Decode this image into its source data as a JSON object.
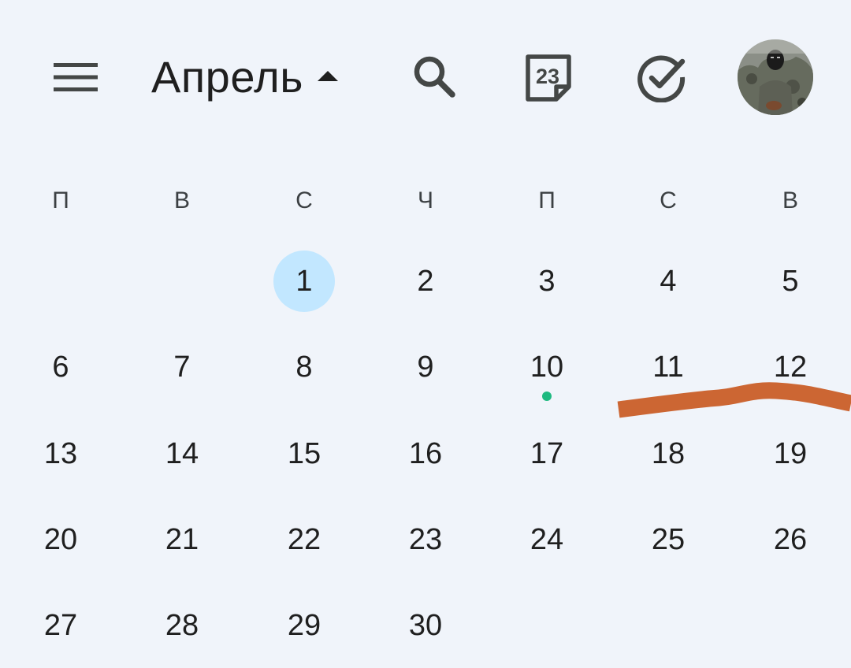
{
  "header": {
    "month": "Апрель",
    "menu_icon": "menu-icon",
    "search_icon": "search-icon",
    "today_badge": "23",
    "tasks_icon": "task-check-icon",
    "avatar_icon": "user-avatar"
  },
  "weekdays": [
    "П",
    "В",
    "С",
    "Ч",
    "П",
    "С",
    "В"
  ],
  "days": [
    "1",
    "2",
    "3",
    "4",
    "5",
    "6",
    "7",
    "8",
    "9",
    "10",
    "11",
    "12",
    "13",
    "14",
    "15",
    "16",
    "17",
    "18",
    "19",
    "20",
    "21",
    "22",
    "23",
    "24",
    "25",
    "26",
    "27",
    "28",
    "29",
    "30"
  ],
  "first_weekday_index": 2,
  "selected_day": "1",
  "event_days": [
    "10"
  ],
  "colors": {
    "background": "#f0f4fa",
    "selected_day_fill": "#c2e7ff",
    "event_dot": "#1eb980",
    "icon": "#444746",
    "scribble": "#cc6633"
  }
}
